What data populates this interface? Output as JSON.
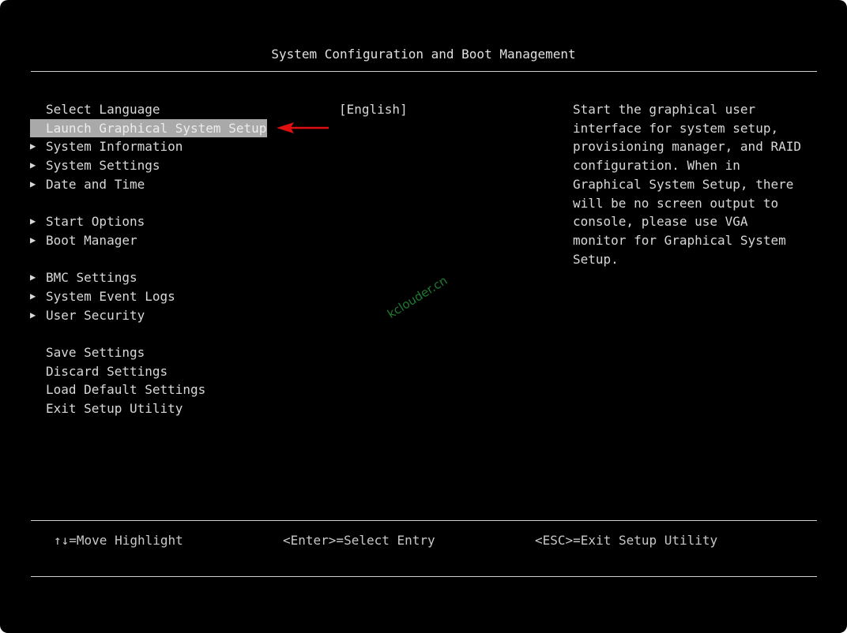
{
  "header": {
    "title": "System Configuration and Boot Management"
  },
  "menu": {
    "items": [
      {
        "label": "Select Language",
        "submenu": false
      },
      {
        "label": "Launch Graphical System Setup",
        "submenu": false,
        "selected": true
      },
      {
        "label": "System Information",
        "submenu": true
      },
      {
        "label": "System Settings",
        "submenu": true
      },
      {
        "label": "Date and Time",
        "submenu": true
      },
      {
        "label": "Start Options",
        "submenu": true
      },
      {
        "label": "Boot Manager",
        "submenu": true
      },
      {
        "label": "BMC Settings",
        "submenu": true
      },
      {
        "label": "System Event Logs",
        "submenu": true
      },
      {
        "label": "User Security",
        "submenu": true
      },
      {
        "label": "Save Settings",
        "submenu": false
      },
      {
        "label": "Discard Settings",
        "submenu": false
      },
      {
        "label": "Load Default Settings",
        "submenu": false
      },
      {
        "label": "Exit Setup Utility",
        "submenu": false
      }
    ],
    "language_value": "[English]"
  },
  "help": {
    "text": "Start the graphical user\ninterface for system setup,\nprovisioning manager, and RAID\nconfiguration. When in\nGraphical System Setup, there\nwill be no screen output to\nconsole, please use VGA\nmonitor for Graphical System\nSetup."
  },
  "footer": {
    "move": "↑↓=Move Highlight",
    "select": "<Enter>=Select Entry",
    "exit": "<ESC>=Exit Setup Utility"
  },
  "watermark": "kclouder.cn",
  "colors": {
    "background": "#000000",
    "text": "#d8d8d8",
    "highlight": "#a9a9a9",
    "annotation_arrow": "#e01010",
    "watermark": "#1e7a32"
  },
  "icons": {
    "submenu": "triangle-right-icon",
    "annotation": "red-arrow-icon"
  }
}
